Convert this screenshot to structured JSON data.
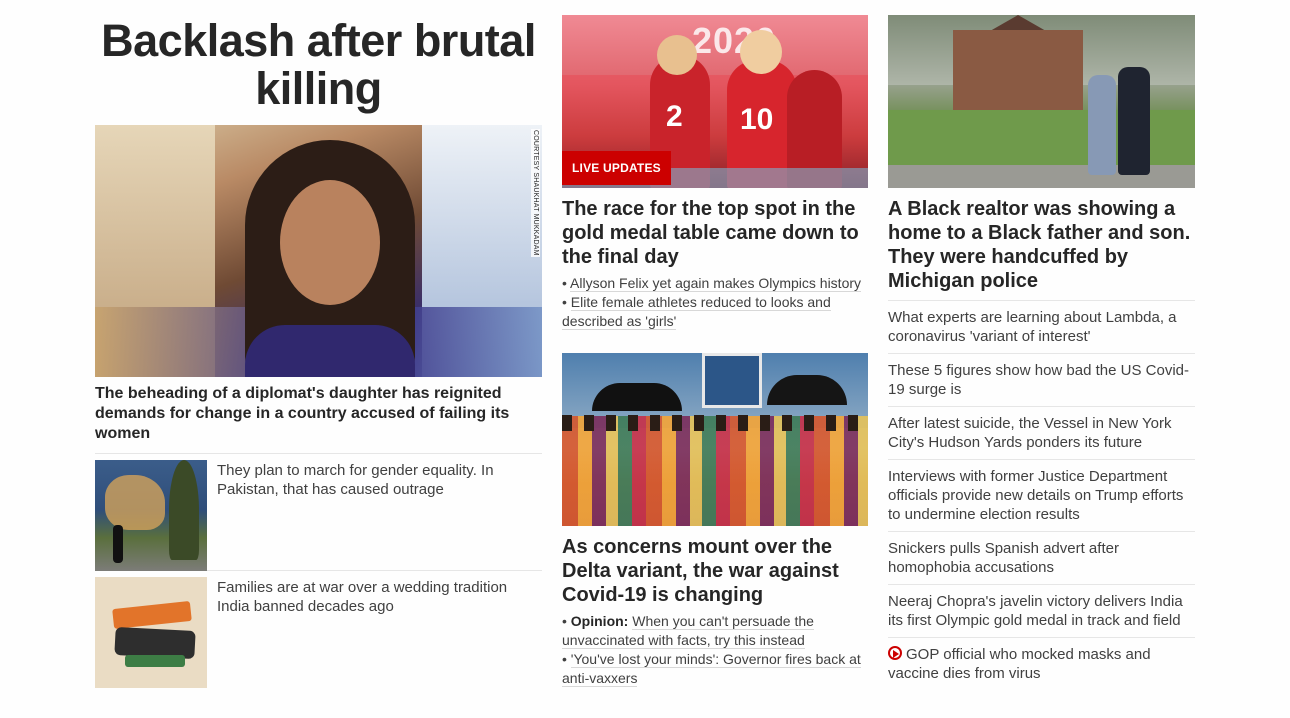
{
  "col1": {
    "headline": "Backlash after brutal killing",
    "hero_credit": "COURTESY SHAUKHAT MUKKADAM",
    "lead_caption": "The beheading of a diplomat's daughter has reignited demands for change in a country accused of failing its women",
    "thumbs": [
      {
        "text": "They plan to march for gender equality. In Pakistan, that has caused outrage"
      },
      {
        "text": "Families are at war over a wedding tradition India banned decades ago"
      }
    ]
  },
  "col2": {
    "badge": "LIVE UPDATES",
    "olympics_headline": "The race for the top spot in the gold medal table came down to the final day",
    "olympics_bullets": [
      "Allyson Felix yet again makes Olympics history",
      "Elite female athletes reduced to looks and described as 'girls'"
    ],
    "delta_headline": "As concerns mount over the Delta variant, the war against Covid-19 is changing",
    "delta_bullets": [
      {
        "prefix": "Opinion:",
        "text": "When you can't persuade the unvaccinated with facts, try this instead"
      },
      {
        "prefix": "",
        "text": "'You've lost your minds': Governor fires back at anti-vaxxers"
      }
    ]
  },
  "col3": {
    "headline": "A Black realtor was showing a home to a Black father and son. They were handcuffed by Michigan police",
    "stories": [
      "What experts are learning about Lambda, a coronavirus 'variant of interest'",
      "These 5 figures show how bad the US Covid-19 surge is",
      "After latest suicide, the Vessel in New York City's Hudson Yards ponders its future",
      "Interviews with former Justice Department officials provide new details on Trump efforts to undermine election results",
      "Snickers pulls Spanish advert after homophobia accusations",
      "Neeraj Chopra's javelin victory delivers India its first Olympic gold medal in track and field",
      "GOP official who mocked masks and vaccine dies from virus"
    ],
    "video_icon": "play-circle-icon"
  },
  "colors": {
    "accent": "#cc0000",
    "text": "#262626"
  }
}
